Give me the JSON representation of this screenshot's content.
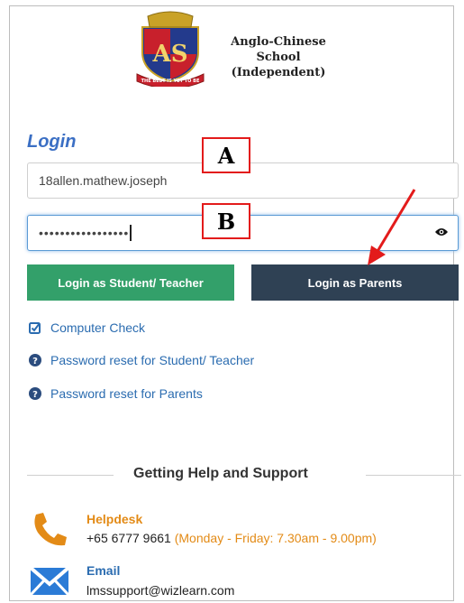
{
  "header": {
    "school_line1": "Anglo-Chinese School",
    "school_line2": "(Independent)",
    "crest_motto": "THE BEST IS YET TO BE"
  },
  "login": {
    "title": "Login",
    "username_value": "18allen.mathew.joseph",
    "password_mask": "•••••••••••••••••",
    "student_button": "Login as Student/ Teacher",
    "parents_button": "Login as Parents"
  },
  "annotations": {
    "label_a": "A",
    "label_b": "B"
  },
  "links": {
    "computer_check": "Computer Check",
    "reset_student": "Password reset for Student/ Teacher",
    "reset_parents": "Password reset for Parents"
  },
  "support": {
    "title": "Getting Help and Support",
    "helpdesk_title": "Helpdesk",
    "helpdesk_phone": "+65 6777 9661",
    "helpdesk_hours": "(Monday - Friday: 7.30am - 9.00pm)",
    "email_title": "Email",
    "email_address": "lmssupport@wizlearn.com"
  },
  "colors": {
    "student_button": "#33a06a",
    "parents_button": "#2f4154",
    "link": "#2b6cb0",
    "accent_orange": "#e38b17",
    "annotation_red": "#e31b1b"
  }
}
